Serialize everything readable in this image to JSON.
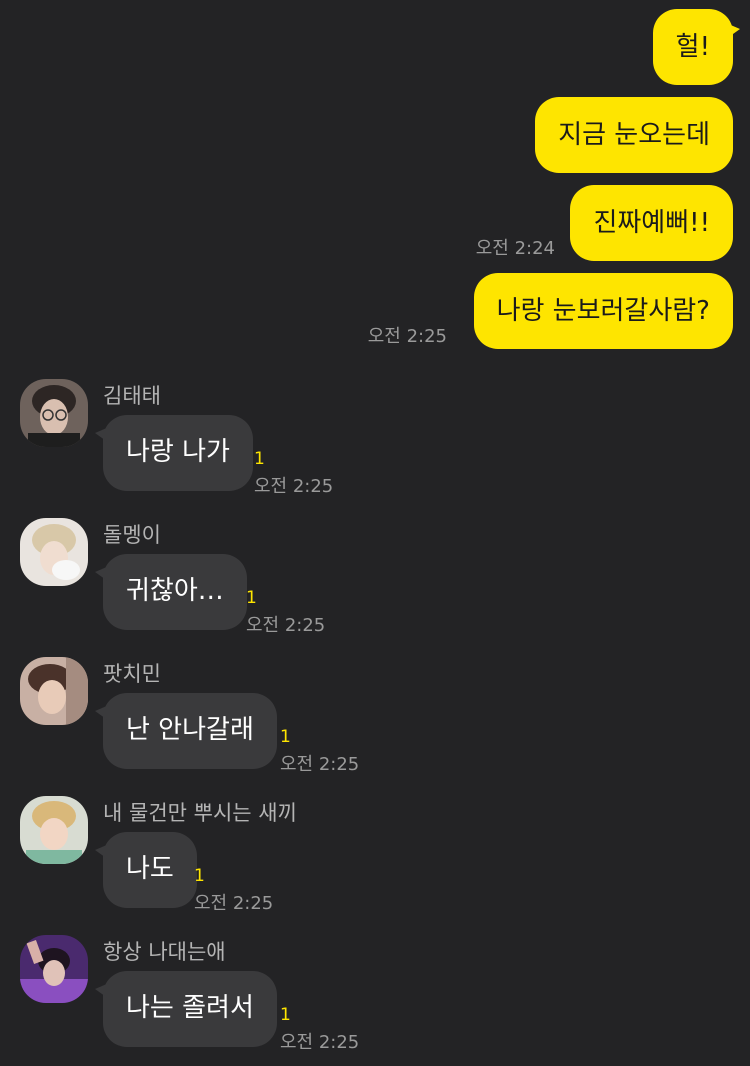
{
  "my_messages": [
    {
      "text": "헐!"
    },
    {
      "text": "지금 눈오는데"
    },
    {
      "text": "진짜예뻐!!",
      "time": "오전 2:24"
    },
    {
      "text": "나랑 눈보러갈사람?",
      "time": "오전 2:25"
    }
  ],
  "other_messages": [
    {
      "sender": "김태태",
      "text": "나랑 나가",
      "unread": "1",
      "time": "오전 2:25"
    },
    {
      "sender": "돌멩이",
      "text": "귀찮아…",
      "unread": "1",
      "time": "오전 2:25"
    },
    {
      "sender": "팟치민",
      "text": "난 안나갈래",
      "unread": "1",
      "time": "오전 2:25"
    },
    {
      "sender": "내 물건만 뿌시는 새끼",
      "text": "나도",
      "unread": "1",
      "time": "오전 2:25"
    },
    {
      "sender": "항상 나대는애",
      "text": "나는 졸려서",
      "unread": "1",
      "time": "오전 2:25"
    }
  ],
  "colors": {
    "background": "#232325",
    "my_bubble": "#fee500",
    "other_bubble": "#3a3a3c",
    "unread": "#fee500"
  }
}
